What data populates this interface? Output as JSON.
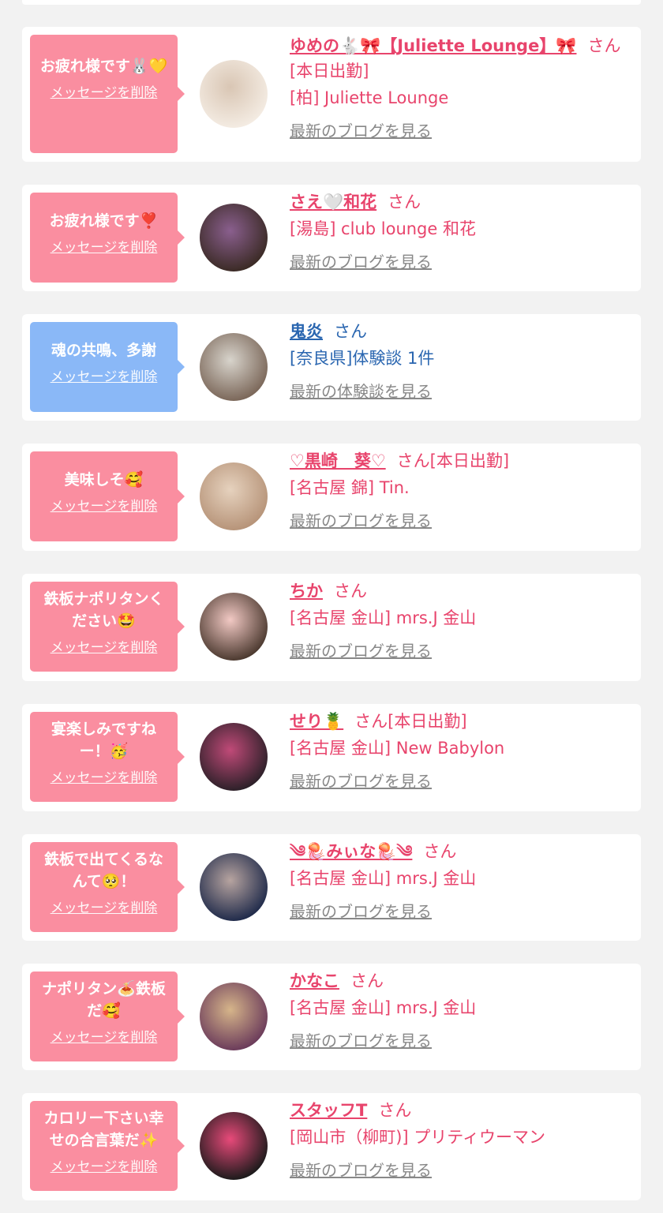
{
  "delete_label": "メッセージを削除",
  "items": [
    {
      "message": "お疲れ様です🐰💛",
      "bubble_color": "pink",
      "name": "ゆめの🐇🎀【Juliette Lounge】🎀",
      "suffix": "さん[本日出勤]",
      "shop": "[柏] Juliette Lounge",
      "link": "最新のブログを見る",
      "avatar_colors": [
        "#f4ece3",
        "#d9c6b4"
      ]
    },
    {
      "message": "お疲れ様です❣️",
      "bubble_color": "pink",
      "name": "さえ🤍和花",
      "suffix": "さん",
      "shop": "[湯島] club lounge 和花",
      "link": "最新のブログを見る",
      "avatar_colors": [
        "#3a2a24",
        "#8a5f8e"
      ]
    },
    {
      "message": "魂の共鳴、多謝",
      "bubble_color": "blue",
      "name": "鬼炎",
      "suffix": "さん",
      "shop": "[奈良県]体験談 1件",
      "link": "最新の体験談を見る",
      "avatar_colors": [
        "#7a6658",
        "#d8d4cc"
      ]
    },
    {
      "message": "美味しそ🥰",
      "bubble_color": "pink",
      "name": "♡黒崎　葵♡",
      "suffix": "さん[本日出勤]",
      "shop": "[名古屋 錦] Tin.",
      "link": "最新のブログを見る",
      "avatar_colors": [
        "#b69378",
        "#e6d2be"
      ]
    },
    {
      "message": "鉄板ナポリタンください🤩",
      "bubble_color": "pink",
      "name": "ちか",
      "suffix": "さん",
      "shop": "[名古屋 金山] mrs.J 金山",
      "link": "最新のブログを見る",
      "avatar_colors": [
        "#4a382e",
        "#f2c9c4"
      ]
    },
    {
      "message": "宴楽しみですねー！🥳",
      "bubble_color": "pink",
      "name": "せり🍍",
      "suffix": "さん[本日出勤]",
      "shop": "[名古屋 金山] New Babylon",
      "link": "最新のブログを見る",
      "avatar_colors": [
        "#2b2028",
        "#c04a78"
      ]
    },
    {
      "message": "鉄板で出てくるなんて🥺！",
      "bubble_color": "pink",
      "name": "༄🪼みぃな🪼༄",
      "suffix": "さん",
      "shop": "[名古屋 金山] mrs.J 金山",
      "link": "最新のブログを見る",
      "avatar_colors": [
        "#1f2a4a",
        "#b7a4a0"
      ]
    },
    {
      "message": "ナポリタン🍝鉄板だ🥰",
      "bubble_color": "pink",
      "name": "かなこ",
      "suffix": "さん",
      "shop": "[名古屋 金山] mrs.J 金山",
      "link": "最新のブログを見る",
      "avatar_colors": [
        "#6a3a5a",
        "#d6b58a"
      ]
    },
    {
      "message": "カロリー下さい幸せの合言葉だ✨",
      "bubble_color": "pink",
      "name": "スタッフT",
      "suffix": "さん",
      "shop": "[岡山市（柳町)] プリティウーマン",
      "link": "最新のブログを見る",
      "avatar_colors": [
        "#1a1a1a",
        "#e84a7a"
      ]
    }
  ]
}
